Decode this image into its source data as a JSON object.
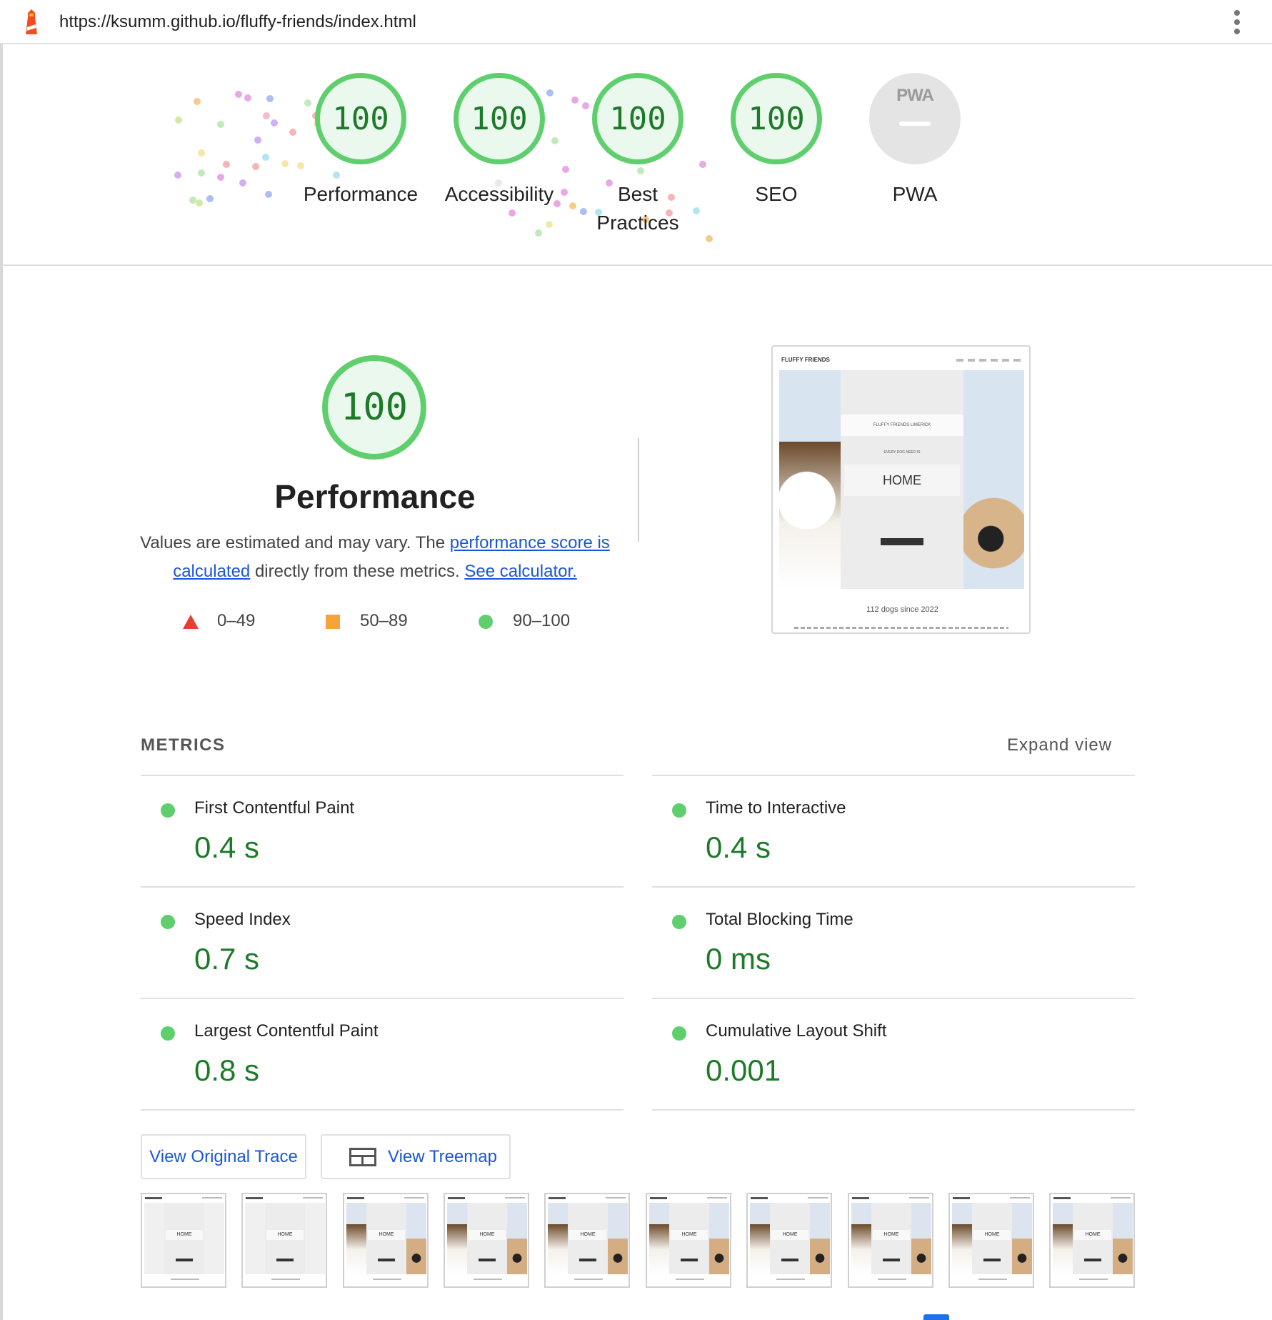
{
  "url_bar": {
    "url": "https://ksumm.github.io/fluffy-friends/index.html"
  },
  "gauges": [
    {
      "label": "Performance",
      "score": "100"
    },
    {
      "label": "Accessibility",
      "score": "100"
    },
    {
      "label": "Best Practices",
      "score": "100"
    },
    {
      "label": "SEO",
      "score": "100"
    }
  ],
  "pwa_gauge": {
    "label": "PWA",
    "badge_text": "PWA"
  },
  "performance": {
    "score": "100",
    "title": "Performance",
    "desc_prefix": "Values are estimated and may vary. The ",
    "desc_link1": "performance score is calculated",
    "desc_mid": " directly from these metrics. ",
    "desc_link2": "See calculator."
  },
  "legend": [
    {
      "range": "0–49",
      "color": "#eb3c2f"
    },
    {
      "range": "50–89",
      "color": "#f6a33a"
    },
    {
      "range": "90–100",
      "color": "#5fcf6e"
    }
  ],
  "screenshot": {
    "brand": "FLUFFY FRIENDS",
    "box_text": "FLUFFY FRIENDS LIMERICK",
    "tagline": "EVERY DOG NEED IS",
    "home": "HOME",
    "caption": "112 dogs since 2022"
  },
  "metrics": {
    "header": "METRICS",
    "expand": "Expand view",
    "items": [
      {
        "title": "First Contentful Paint",
        "value": "0.4 s"
      },
      {
        "title": "Time to Interactive",
        "value": "0.4 s"
      },
      {
        "title": "Speed Index",
        "value": "0.7 s"
      },
      {
        "title": "Total Blocking Time",
        "value": "0 ms"
      },
      {
        "title": "Largest Contentful Paint",
        "value": "0.8 s"
      },
      {
        "title": "Cumulative Layout Shift",
        "value": "0.001"
      }
    ]
  },
  "buttons": {
    "view_trace": "View Original Trace",
    "view_treemap": "View Treemap"
  },
  "filmstrip": {
    "frame_home": "HOME"
  },
  "colors": {
    "pass_green": "#5fcf6e",
    "pass_text": "#1c7a28",
    "link_blue": "#1a56db"
  }
}
